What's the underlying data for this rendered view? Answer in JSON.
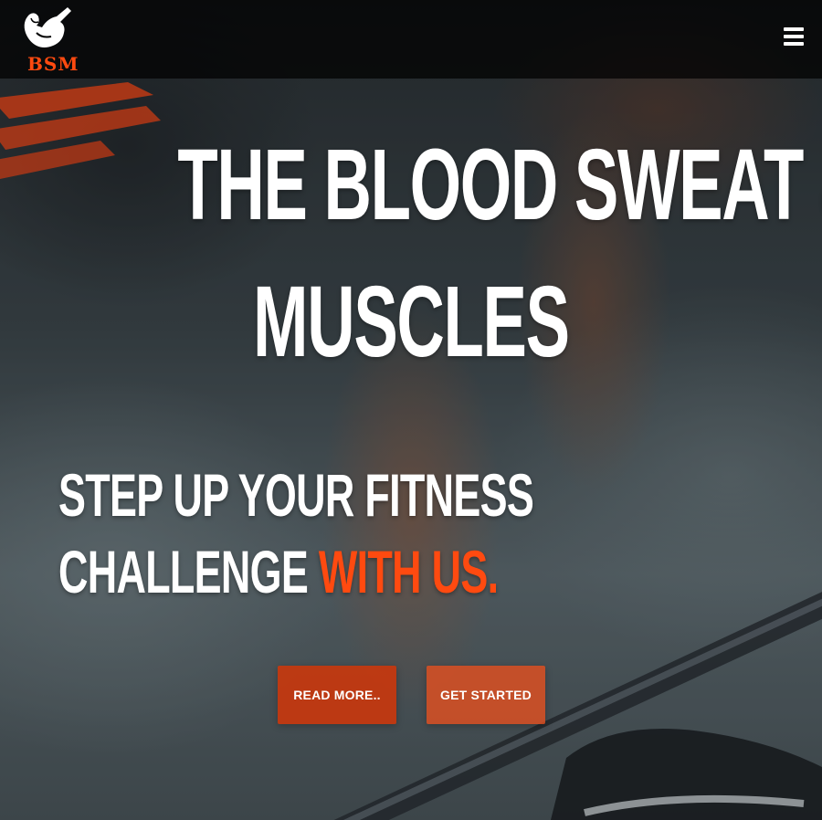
{
  "navbar": {
    "brand": {
      "logo_icon": "bodybuilder-flex-icon",
      "text": "BSM"
    },
    "menu_icon": "hamburger-menu-icon"
  },
  "hero": {
    "headline": {
      "line1_main": "THE BLOOD SWEAT ",
      "line1_accent": "&",
      "line2": "MUSCLES"
    },
    "subheadline": {
      "line1": "STEP UP YOUR FITNESS",
      "line2_main": "CHALLENGE ",
      "line2_accent": "WITH US."
    },
    "buttons": {
      "read_more": "READ MORE..",
      "get_started": "GET STARTED"
    }
  },
  "colors": {
    "accent": "#ff4a10",
    "button_primary": "#cd370a",
    "button_secondary": "#e8501e",
    "text": "#ffffff",
    "navbar_bg": "#000000"
  }
}
